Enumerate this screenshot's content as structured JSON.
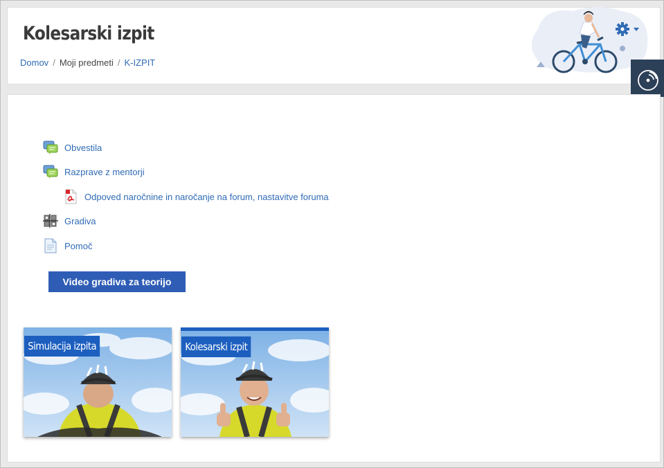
{
  "header": {
    "title": "Kolesarski izpit",
    "breadcrumb": [
      {
        "label": "Domov",
        "link": true
      },
      {
        "label": "Moji predmeti",
        "link": false
      },
      {
        "label": "K-IZPIT",
        "link": true
      }
    ],
    "breadcrumb_separator": "/"
  },
  "icons": {
    "settings": "gear-icon",
    "dropdown": "caret-down-icon",
    "drawer": "block-drawer-icon"
  },
  "activities": [
    {
      "label": "Obvestila",
      "icon": "forum-icon"
    },
    {
      "label": "Razprave z mentorji",
      "icon": "forum-icon"
    },
    {
      "label": "Odpoved naročnine in naročanje na forum, nastavitve foruma",
      "icon": "pdf-icon"
    },
    {
      "label": "Gradiva",
      "icon": "book-icon"
    },
    {
      "label": "Pomoč",
      "icon": "page-icon"
    }
  ],
  "video_button": "Video gradiva za teorijo",
  "tiles": [
    {
      "label": "Simulacija izpita"
    },
    {
      "label": "Kolesarski izpit"
    }
  ],
  "colors": {
    "link": "#2f6bb5",
    "button": "#2f5db6",
    "tile_label_bg": "#1c5fbf",
    "drawer_bg": "#2c4058"
  }
}
